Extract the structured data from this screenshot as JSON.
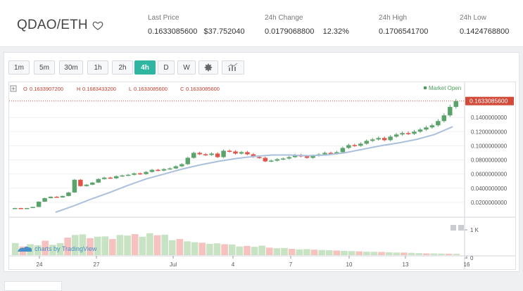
{
  "header": {
    "pair": "QDAO/ETH",
    "last_price": {
      "label": "Last Price",
      "value": "0.1633085600",
      "usd": "$37.752040"
    },
    "change": {
      "label": "24h Change",
      "value": "0.0179068800",
      "percent": "12.32%"
    },
    "high": {
      "label": "24h High",
      "value": "0.1706541700"
    },
    "low": {
      "label": "24h Low",
      "value": "0.1424768800"
    }
  },
  "toolbar": {
    "intervals": [
      "1m",
      "5m",
      "30m",
      "1h",
      "2h",
      "4h",
      "D",
      "W"
    ],
    "active_interval": "4h",
    "settings_icon": "gear-icon",
    "indicators_icon": "indicators-icon"
  },
  "legend": {
    "o_label": "O",
    "o": "0.1633907200",
    "h_label": "H",
    "h": "0.1683433200",
    "l_label": "L",
    "l": "0.1633085600",
    "c_label": "C",
    "c": "0.1633085600"
  },
  "market_status": "Market Open",
  "current_price_tag": "0.1633085600",
  "watermark": "charts by TradingView",
  "chart_data": {
    "type": "candlestick",
    "price_axis": {
      "ticks": [
        "0.1400000000",
        "0.1200000000",
        "0.1000000000",
        "0.0800000000",
        "0.0600000000",
        "0.0400000000",
        "0.0200000000"
      ],
      "ylim": [
        0.005,
        0.172
      ]
    },
    "volume_axis": {
      "ticks": [
        "1 K",
        "0"
      ]
    },
    "x_axis": {
      "ticks": [
        "24",
        "27",
        "Jul",
        "4",
        "7",
        "10",
        "13",
        "16"
      ]
    },
    "close_series": [
      0.012,
      0.0115,
      0.012,
      0.0135,
      0.021,
      0.026,
      0.028,
      0.027,
      0.029,
      0.034,
      0.052,
      0.043,
      0.045,
      0.048,
      0.053,
      0.055,
      0.054,
      0.057,
      0.058,
      0.059,
      0.061,
      0.06,
      0.063,
      0.066,
      0.065,
      0.067,
      0.068,
      0.071,
      0.074,
      0.083,
      0.09,
      0.088,
      0.087,
      0.089,
      0.084,
      0.093,
      0.092,
      0.089,
      0.091,
      0.088,
      0.084,
      0.083,
      0.078,
      0.079,
      0.081,
      0.082,
      0.084,
      0.087,
      0.085,
      0.083,
      0.086,
      0.088,
      0.09,
      0.089,
      0.091,
      0.097,
      0.101,
      0.1,
      0.103,
      0.107,
      0.109,
      0.111,
      0.108,
      0.113,
      0.116,
      0.118,
      0.117,
      0.12,
      0.123,
      0.126,
      0.129,
      0.135,
      0.143,
      0.155,
      0.163
    ],
    "moving_average": [
      0.006,
      0.015,
      0.025,
      0.034,
      0.044,
      0.053,
      0.06,
      0.067,
      0.073,
      0.078,
      0.082,
      0.085,
      0.087,
      0.087,
      0.086,
      0.087,
      0.09,
      0.095,
      0.1,
      0.104,
      0.109,
      0.116,
      0.127
    ],
    "volume_series": [
      420,
      300,
      380,
      340,
      500,
      360,
      420,
      610,
      700,
      720,
      590,
      640,
      650,
      560,
      700,
      680,
      730,
      640,
      760,
      690,
      710,
      520,
      560,
      480,
      450,
      430,
      390,
      410,
      380,
      370,
      300,
      320,
      290,
      330,
      260,
      240,
      250,
      220,
      200,
      210,
      190,
      180,
      170,
      160,
      150,
      140,
      130,
      120,
      115,
      110,
      100,
      90,
      90,
      80,
      70,
      60,
      60,
      55,
      50,
      45
    ]
  }
}
